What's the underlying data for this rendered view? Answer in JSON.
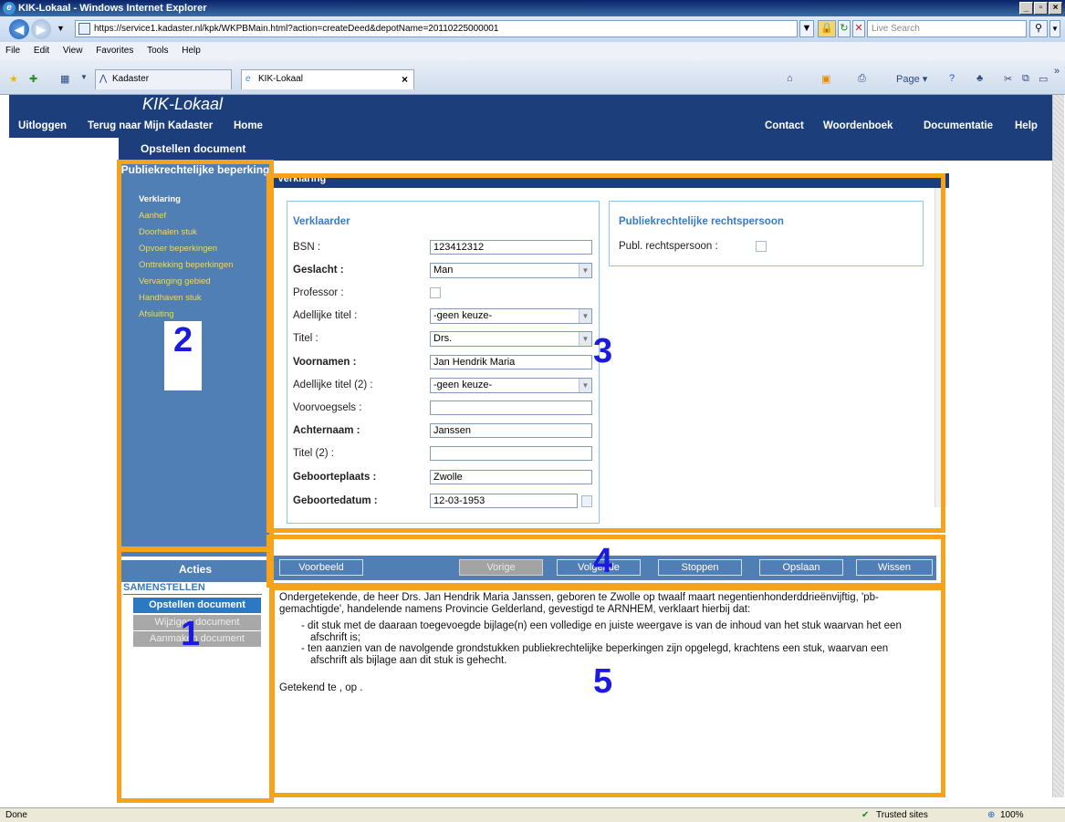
{
  "browser": {
    "title": "KIK-Lokaal - Windows Internet Explorer",
    "url": "https://service1.kadaster.nl/kpk/WKPBMain.html?action=createDeed&depotName=20110225000001",
    "search_placeholder": "Live Search",
    "menu": [
      "File",
      "Edit",
      "View",
      "Favorites",
      "Tools",
      "Help"
    ],
    "tabs": [
      "Kadaster",
      "KIK-Lokaal"
    ],
    "toolbar_page": "Page",
    "status": "Done",
    "zone": "Trusted sites",
    "zoom": "100%"
  },
  "site": {
    "brand": "KIK-Lokaal",
    "nav_left": [
      "Uitloggen",
      "Terug naar Mijn Kadaster",
      "Home"
    ],
    "nav_right": [
      "Contact",
      "Woordenboek",
      "Documentatie",
      "Help"
    ],
    "subheader": "Opstellen document"
  },
  "sidebar": {
    "section_title": "Publiekrechtelijke beperking",
    "items": [
      {
        "label": "Verklaring",
        "current": true
      },
      {
        "label": "Aanhef"
      },
      {
        "label": "Doorhalen stuk"
      },
      {
        "label": "Opvoer beperkingen"
      },
      {
        "label": "Onttrekking beperkingen"
      },
      {
        "label": "Vervanging gebied"
      },
      {
        "label": "Handhaven stuk"
      },
      {
        "label": "Afsluiting"
      }
    ]
  },
  "form": {
    "strip_title": "Verklaring",
    "title": "Verklaarder",
    "fields": {
      "bsn": {
        "label": "BSN :",
        "value": "123412312"
      },
      "geslacht": {
        "label": "Geslacht :",
        "value": "Man"
      },
      "professor": {
        "label": "Professor :"
      },
      "adellijke_titel": {
        "label": "Adellijke titel :",
        "value": "-geen keuze-"
      },
      "titel": {
        "label": "Titel :",
        "value": "Drs."
      },
      "voornamen": {
        "label": "Voornamen :",
        "value": "Jan Hendrik Maria"
      },
      "adellijke_titel2": {
        "label": "Adellijke titel (2) :",
        "value": "-geen keuze-"
      },
      "voorvoegsels": {
        "label": "Voorvoegsels :",
        "value": ""
      },
      "achternaam": {
        "label": "Achternaam :",
        "value": "Janssen"
      },
      "titel2": {
        "label": "Titel (2) :",
        "value": ""
      },
      "geboorteplaats": {
        "label": "Geboorteplaats :",
        "value": "Zwolle"
      },
      "geboortedatum": {
        "label": "Geboortedatum :",
        "value": "12-03-1953"
      }
    }
  },
  "right_form": {
    "title": "Publiekrechtelijke rechtspersoon",
    "field_label": "Publ. rechtspersoon :"
  },
  "actions": {
    "voorbeeld": "Voorbeeld",
    "vorige": "Vorige",
    "volgende": "Volgende",
    "stoppen": "Stoppen",
    "opslaan": "Opslaan",
    "wissen": "Wissen"
  },
  "left_actions": {
    "title": "Acties",
    "section": "SAMENSTELLEN",
    "opstellen": "Opstellen document",
    "wijzigen": "Wijzigen document",
    "aanmaken": "Aanmaken document"
  },
  "preview": {
    "p1": "Ondergetekende, de heer Drs. Jan Hendrik Maria Janssen, geboren te Zwolle op twaalf maart negentienhonderddrieënvijftig, 'pb-gemachtigde', handelende namens Provincie Gelderland, gevestigd te ARNHEM, verklaart hierbij dat:",
    "b1": "dit stuk met de daaraan toegevoegde bijlage(n) een volledige en juiste weergave is van de inhoud van het stuk waarvan het een afschrift is;",
    "b2": "ten aanzien van de navolgende grondstukken publiekrechtelijke beperkingen zijn opgelegd, krachtens een stuk, waarvan een afschrift als bijlage aan dit stuk is gehecht.",
    "sign": "Getekend te , op ."
  },
  "annotations": [
    "1",
    "2",
    "3",
    "4",
    "5"
  ],
  "colors": {
    "nav": "#1c3f7c",
    "panel": "#4f7fb5",
    "annotation": "#f7a21b",
    "annotation_number": "#1a1ae0",
    "link": "#f0d860"
  }
}
